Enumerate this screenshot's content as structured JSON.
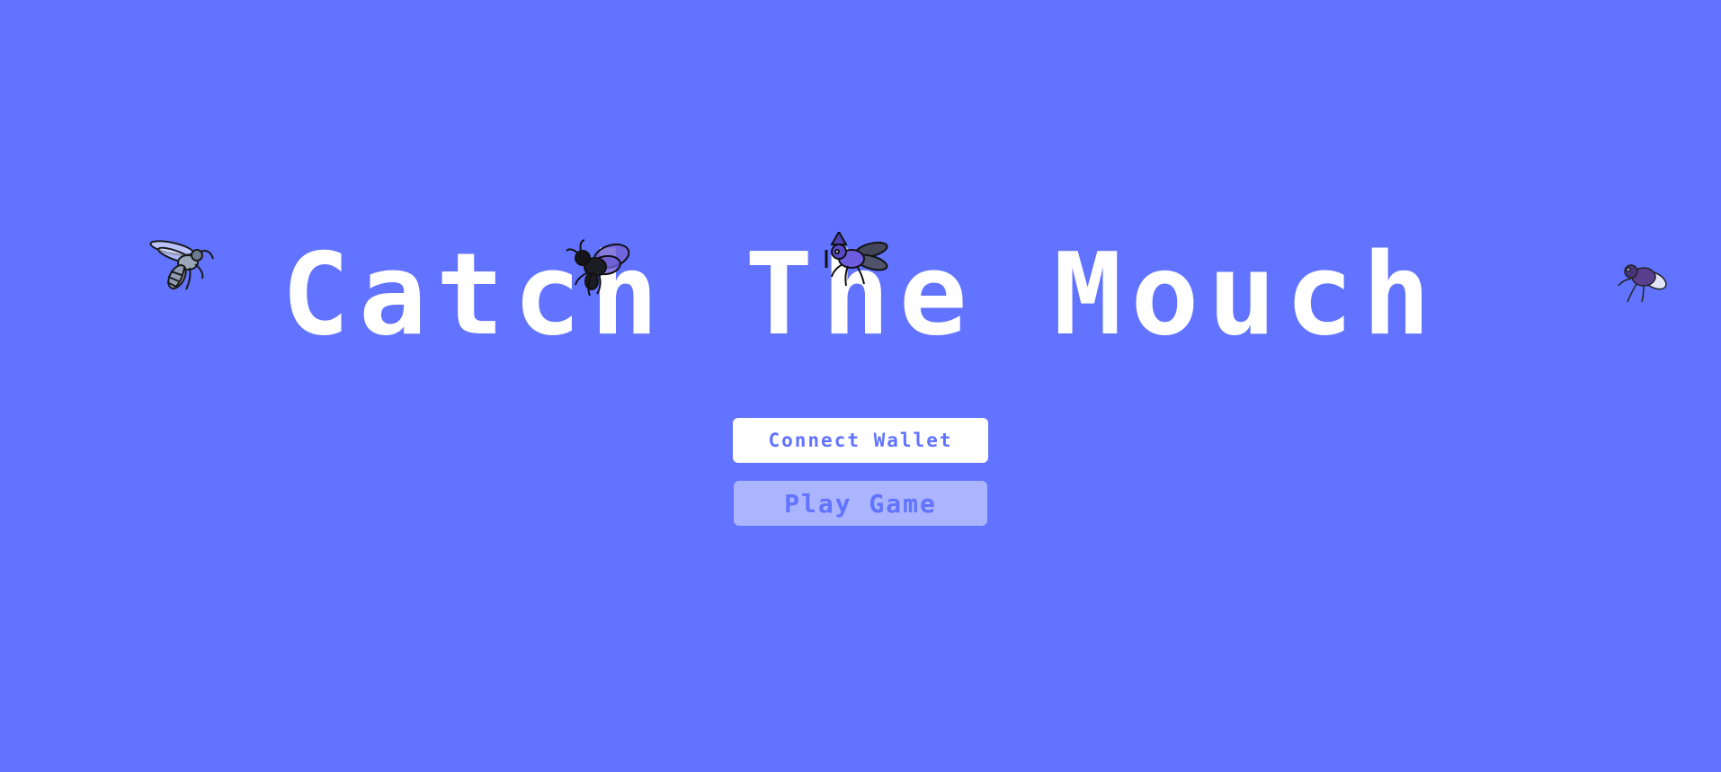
{
  "colors": {
    "background": "#6173ff",
    "title_text": "#ffffff",
    "connect_button_bg": "#ffffff",
    "connect_button_text": "#6173ff",
    "play_button_bg": "#aab4ff",
    "play_button_text": "#6173ff"
  },
  "title": "Catch The Mouch",
  "buttons": {
    "connect_label": "Connect Wallet",
    "play_label": "Play Game",
    "play_disabled": true
  },
  "icons": {
    "fly_1": "striped-wasp-fly-icon",
    "fly_2": "black-bee-fly-icon",
    "fly_3": "wizard-hat-fly-icon",
    "fly_4": "purple-housefly-icon"
  }
}
